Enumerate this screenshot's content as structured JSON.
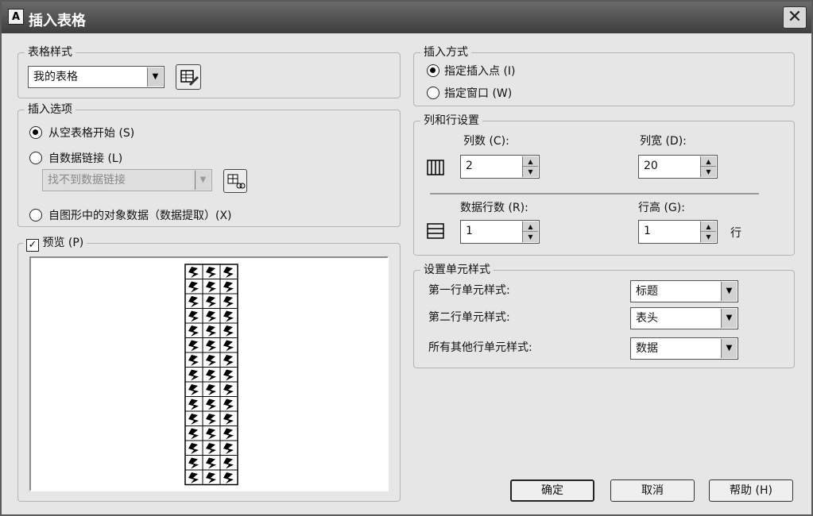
{
  "window": {
    "title": "插入表格",
    "app_icon": "autocad-icon",
    "close_icon": "close-icon"
  },
  "table_style": {
    "legend": "表格样式",
    "selected": "我的表格",
    "edit_icon": "table-style-edit-icon"
  },
  "insert_options": {
    "legend": "插入选项",
    "opt_empty": "从空表格开始 (S)",
    "opt_datalink": "自数据链接 (L)",
    "datalink_value": "找不到数据链接",
    "datalink_icon": "data-link-manager-icon",
    "opt_extract": "自图形中的对象数据（数据提取）(X)"
  },
  "preview": {
    "label": "预览 (P)",
    "checked": true,
    "rows": 15,
    "cols": 3
  },
  "insertion": {
    "legend": "插入方式",
    "opt_point": "指定插入点 (I)",
    "opt_window": "指定窗口 (W)"
  },
  "colrow": {
    "legend": "列和行设置",
    "columns_label": "列数 (C):",
    "columns_value": "2",
    "colwidth_label": "列宽 (D):",
    "colwidth_value": "20",
    "datarows_label": "数据行数 (R):",
    "datarows_value": "1",
    "rowheight_label": "行高 (G):",
    "rowheight_value": "1",
    "row_unit": "行",
    "columns_icon": "columns-icon",
    "rows_icon": "rows-icon"
  },
  "cell_styles": {
    "legend": "设置单元样式",
    "first_row_label": "第一行单元样式:",
    "first_row_value": "标题",
    "second_row_label": "第二行单元样式:",
    "second_row_value": "表头",
    "other_rows_label": "所有其他行单元样式:",
    "other_rows_value": "数据"
  },
  "buttons": {
    "ok": "确定",
    "cancel": "取消",
    "help": "帮助 (H)"
  }
}
